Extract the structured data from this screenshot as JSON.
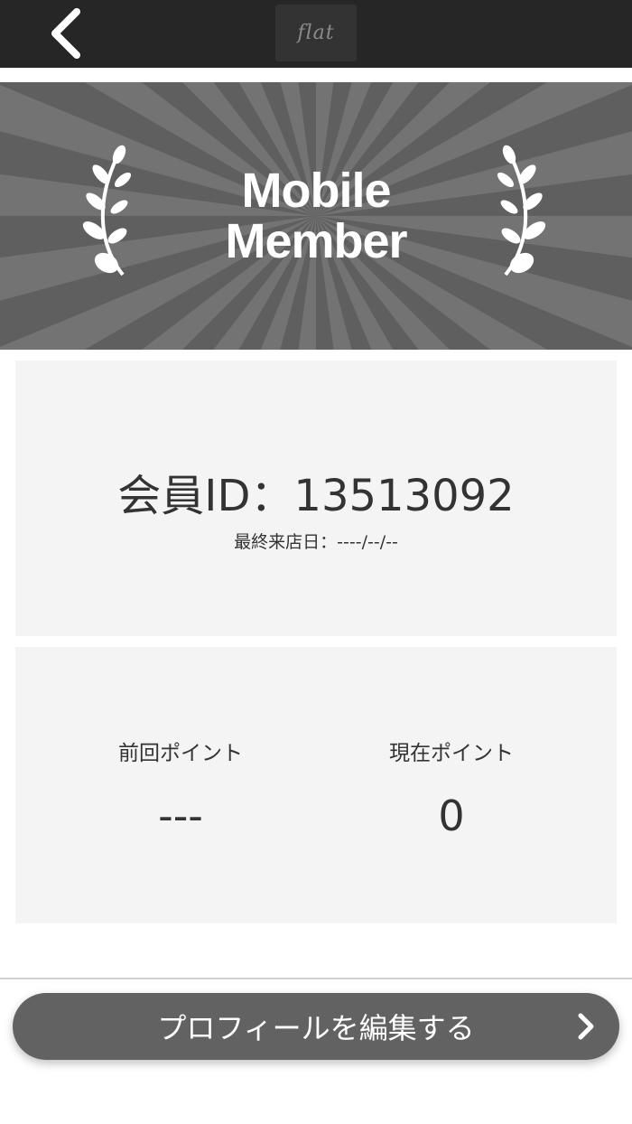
{
  "header": {
    "back_icon": "chevron-left-icon",
    "logo_text": "flat"
  },
  "banner": {
    "title_line1": "Mobile",
    "title_line2": "Member",
    "decoration": "laurel-icon"
  },
  "member": {
    "id_text": "会員ID：13513092",
    "last_visit_text": "最終来店日：----/--/--"
  },
  "points": {
    "previous_label": "前回ポイント",
    "previous_value": "---",
    "current_label": "現在ポイント",
    "current_value": "0"
  },
  "actions": {
    "edit_profile_label": "プロフィールを編集する",
    "edit_profile_icon": "chevron-right-icon"
  },
  "colors": {
    "topbar": "#262626",
    "banner": "#5f5f5f",
    "card": "#f4f4f4",
    "button": "#626262"
  }
}
